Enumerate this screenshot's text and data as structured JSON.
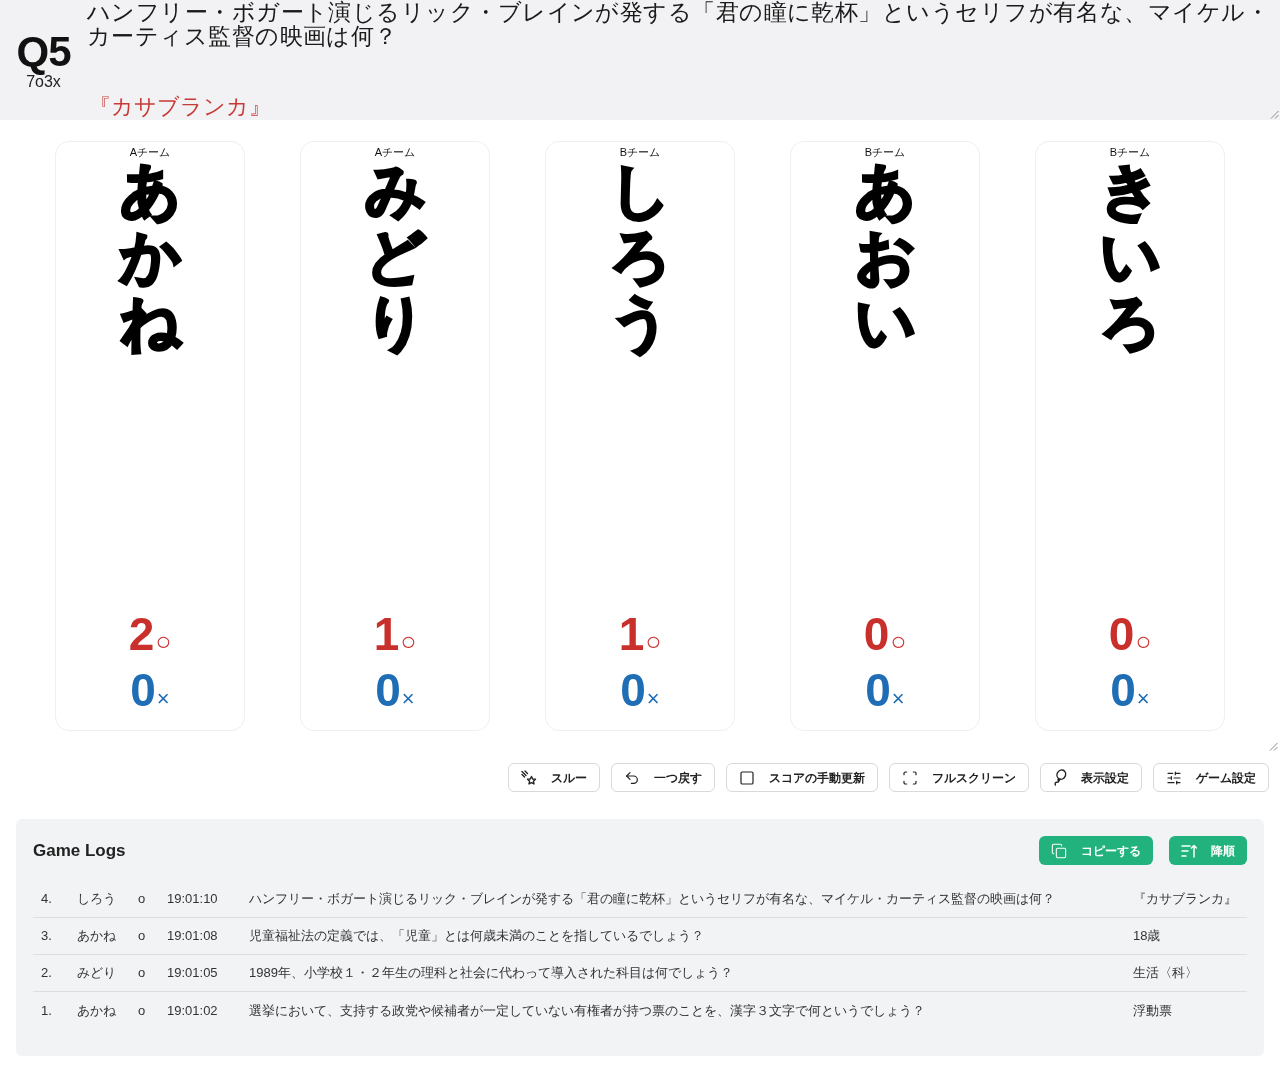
{
  "question_panel": {
    "number": "Q5",
    "tally": "7o3x",
    "question": "ハンフリー・ボガート演じるリック・ブレインが発する「君の瞳に乾杯」というセリフが有名な、マイケル・カーティス監督の映画は何？",
    "answer": "『カサブランカ』"
  },
  "players": [
    {
      "team": "Aチーム",
      "name": "あかね",
      "correct": "2",
      "correct_mark": "○",
      "wrong": "0",
      "wrong_mark": "×"
    },
    {
      "team": "Aチーム",
      "name": "みどり",
      "correct": "1",
      "correct_mark": "○",
      "wrong": "0",
      "wrong_mark": "×"
    },
    {
      "team": "Bチーム",
      "name": "しろう",
      "correct": "1",
      "correct_mark": "○",
      "wrong": "0",
      "wrong_mark": "×"
    },
    {
      "team": "Bチーム",
      "name": "あおい",
      "correct": "0",
      "correct_mark": "○",
      "wrong": "0",
      "wrong_mark": "×"
    },
    {
      "team": "Bチーム",
      "name": "きいろ",
      "correct": "0",
      "correct_mark": "○",
      "wrong": "0",
      "wrong_mark": "×"
    }
  ],
  "toolbar": [
    "スルー",
    "一つ戻す",
    "スコアの手動更新",
    "フルスクリーン",
    "表示設定",
    "ゲーム設定"
  ],
  "game_logs": {
    "title": "Game Logs",
    "buttons": [
      "コピーする",
      "降順"
    ],
    "rows": [
      {
        "number": "4.",
        "player": "しろう",
        "result": "o",
        "time": "19:01:10",
        "question": "ハンフリー・ボガート演じるリック・ブレインが発する「君の瞳に乾杯」というセリフが有名な、マイケル・カーティス監督の映画は何？",
        "answer": "『カサブランカ』"
      },
      {
        "number": "3.",
        "player": "あかね",
        "result": "o",
        "time": "19:01:08",
        "question": "児童福祉法の定義では、「児童」とは何歳未満のことを指しているでしょう？",
        "answer": "18歳"
      },
      {
        "number": "2.",
        "player": "みどり",
        "result": "o",
        "time": "19:01:05",
        "question": "1989年、小学校１・２年生の理科と社会に代わって導入された科目は何でしょう？",
        "answer": "生活〈科〉"
      },
      {
        "number": "1.",
        "player": "あかね",
        "result": "o",
        "time": "19:01:02",
        "question": "選挙において、支持する政党や候補者が一定していない有権者が持つ票のことを、漢字３文字で何というでしょう？",
        "answer": "浮動票"
      }
    ]
  }
}
